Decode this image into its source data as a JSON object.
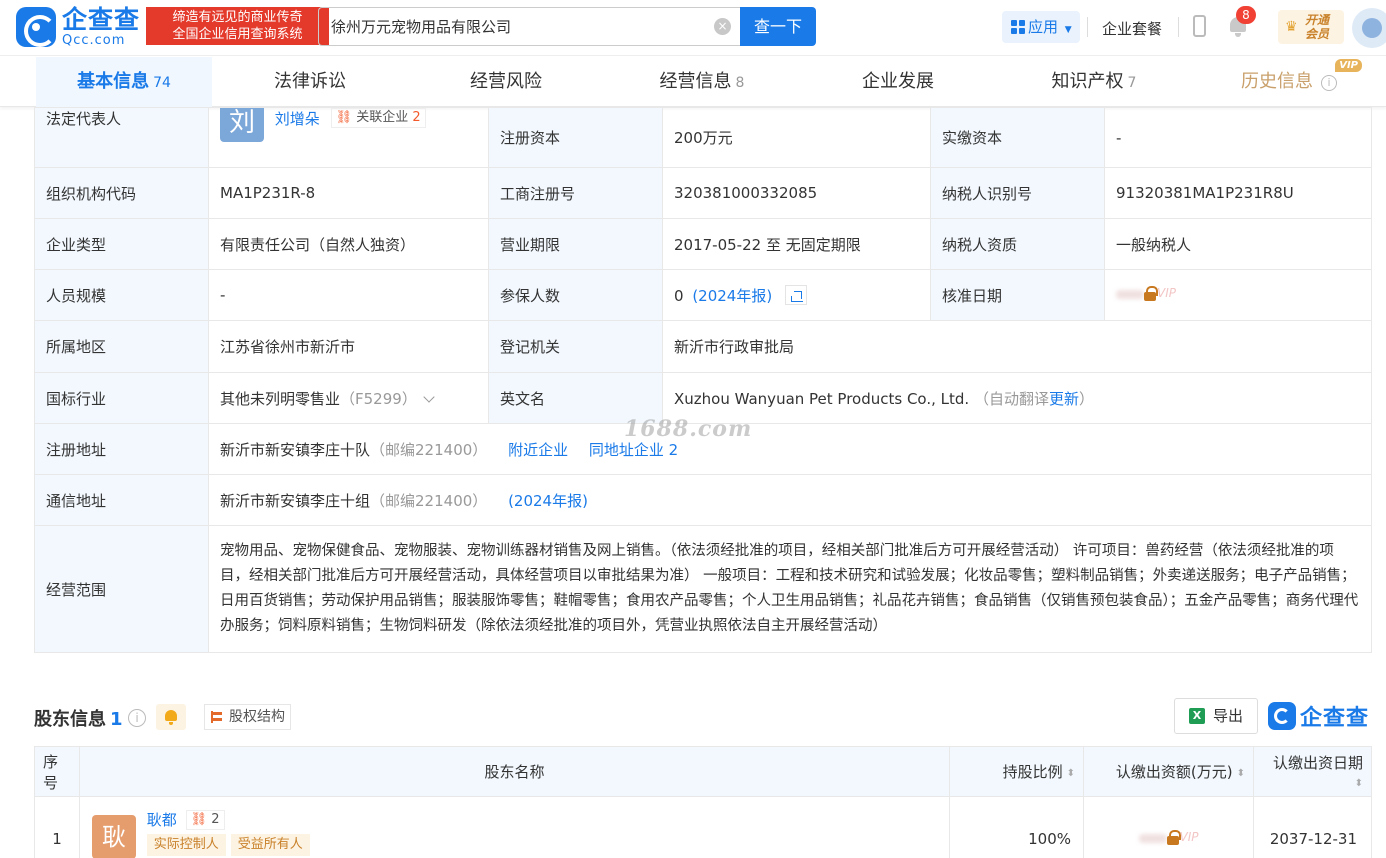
{
  "header": {
    "logo_cn": "企查查",
    "logo_en": "Qcc.com",
    "slogan_line1": "缔造有远见的商业传奇",
    "slogan_line2": "全国企业信用查询系统",
    "search_value": "徐州万元宠物用品有限公司",
    "search_button": "查一下",
    "app_label": "应用",
    "suite_label": "企业套餐",
    "notification_count": "8",
    "vip_line1": "开通",
    "vip_line2": "会员"
  },
  "tabs": [
    {
      "label": "基本信息",
      "count": "74"
    },
    {
      "label": "法律诉讼",
      "count": ""
    },
    {
      "label": "经营风险",
      "count": ""
    },
    {
      "label": "经营信息",
      "count": "8"
    },
    {
      "label": "企业发展",
      "count": ""
    },
    {
      "label": "知识产权",
      "count": "7"
    },
    {
      "label": "历史信息",
      "count": "",
      "badge": "VIP"
    }
  ],
  "info": {
    "legal_rep_label": "法定代表人",
    "legal_rep_avatar": "刘",
    "legal_rep_name": "刘增朵",
    "related_label": "关联企业",
    "related_count": "2",
    "reg_capital_label": "注册资本",
    "reg_capital": "200万元",
    "paid_capital_label": "实缴资本",
    "paid_capital": "-",
    "org_code_label": "组织机构代码",
    "org_code": "MA1P231R-8",
    "biz_reg_no_label": "工商注册号",
    "biz_reg_no": "320381000332085",
    "taxpayer_id_label": "纳税人识别号",
    "taxpayer_id": "91320381MA1P231R8U",
    "company_type_label": "企业类型",
    "company_type": "有限责任公司（自然人独资）",
    "term_label": "营业期限",
    "term": "2017-05-22 至 无固定期限",
    "taxpayer_qual_label": "纳税人资质",
    "taxpayer_qual": "一般纳税人",
    "staff_size_label": "人员规模",
    "staff_size": "-",
    "insured_label": "参保人数",
    "insured_count": "0",
    "insured_report": "(2024年报)",
    "approval_date_label": "核准日期",
    "vip_text": "VIP",
    "region_label": "所属地区",
    "region": "江苏省徐州市新沂市",
    "authority_label": "登记机关",
    "authority": "新沂市行政审批局",
    "industry_label": "国标行业",
    "industry": "其他未列明零售业",
    "industry_code": "（F5299）",
    "english_name_label": "英文名",
    "english_name": "Xuzhou Wanyuan Pet Products Co., Ltd.",
    "auto_translate": "（自动翻译",
    "update_link": "更新",
    "paren_close": "）",
    "reg_address_label": "注册地址",
    "reg_address": "新沂市新安镇李庄十队",
    "reg_postcode": "（邮编221400）",
    "nearby_link": "附近企业",
    "same_address_link": "同地址企业",
    "same_address_count": "2",
    "mail_address_label": "通信地址",
    "mail_address": "新沂市新安镇李庄十组",
    "mail_postcode": "（邮编221400）",
    "mail_report": "(2024年报)",
    "scope_label": "经营范围",
    "scope": "宠物用品、宠物保健食品、宠物服装、宠物训练器材销售及网上销售。（依法须经批准的项目，经相关部门批准后方可开展经营活动） 许可项目：兽药经营（依法须经批准的项目，经相关部门批准后方可开展经营活动，具体经营项目以审批结果为准） 一般项目：工程和技术研究和试验发展；化妆品零售；塑料制品销售；外卖递送服务；电子产品销售；日用百货销售；劳动保护用品销售；服装服饰零售；鞋帽零售；食用农产品零售；个人卫生用品销售；礼品花卉销售；食品销售（仅销售预包装食品）；五金产品零售；商务代理代办服务；饲料原料销售；生物饲料研发（除依法须经批准的项目外，凭营业执照依法自主开展经营活动）"
  },
  "watermark": "1688.com",
  "shareholders": {
    "title": "股东信息",
    "count": "1",
    "equity_button": "股权结构",
    "export_button": "导出",
    "logo": "企查查",
    "columns": [
      "序号",
      "股东名称",
      "持股比例",
      "认缴出资额(万元)",
      "认缴出资日期"
    ],
    "rows": [
      {
        "index": "1",
        "avatar": "耿",
        "name": "耿都",
        "related_count": "2",
        "tags": [
          "实际控制人",
          "受益所有人"
        ],
        "ratio": "100%",
        "amount_vip": "VIP",
        "date": "2037-12-31"
      }
    ]
  }
}
